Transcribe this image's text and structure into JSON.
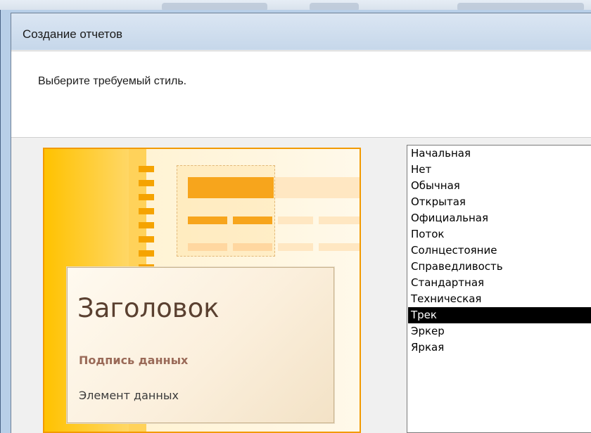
{
  "window": {
    "title": "Создание отчетов"
  },
  "wizard": {
    "prompt": "Выберите требуемый стиль."
  },
  "preview": {
    "title": "Заголовок",
    "caption": "Подпись данных",
    "element": "Элемент данных"
  },
  "styles": {
    "items": [
      "Начальная",
      "Нет",
      "Обычная",
      "Открытая",
      "Официальная",
      "Поток",
      "Солнцестояние",
      "Справедливость",
      "Стандартная",
      "Техническая",
      "Трек",
      "Эркер",
      "Яркая"
    ],
    "selected": "Трек"
  },
  "colors": {
    "accent_orange": "#f29a00",
    "selection": "#000000"
  }
}
